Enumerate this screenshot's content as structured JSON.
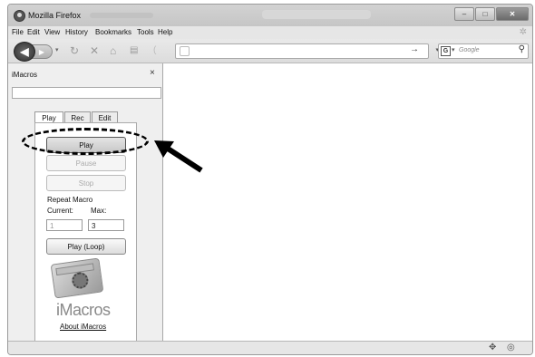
{
  "window": {
    "title": "Mozilla Firefox"
  },
  "menubar": {
    "items": [
      "File",
      "Edit",
      "View",
      "History",
      "Bookmarks",
      "Tools",
      "Help"
    ]
  },
  "search": {
    "placeholder": "Google",
    "engine_letter": "G"
  },
  "sidebar": {
    "title": "iMacros",
    "close_label": "×",
    "tabs": [
      "Play",
      "Rec",
      "Edit"
    ],
    "active_tab": "Play",
    "buttons": {
      "play": "Play",
      "pause": "Pause",
      "stop": "Stop",
      "play_loop": "Play (Loop)"
    },
    "repeat_label": "Repeat Macro",
    "current_label": "Current:",
    "max_label": "Max:",
    "current_value": "1",
    "max_value": "3",
    "logo_text": "iMacros",
    "about_link": "About iMacros"
  },
  "annotation": {
    "style": "dashed ellipse and arrow pointing to Play button"
  }
}
